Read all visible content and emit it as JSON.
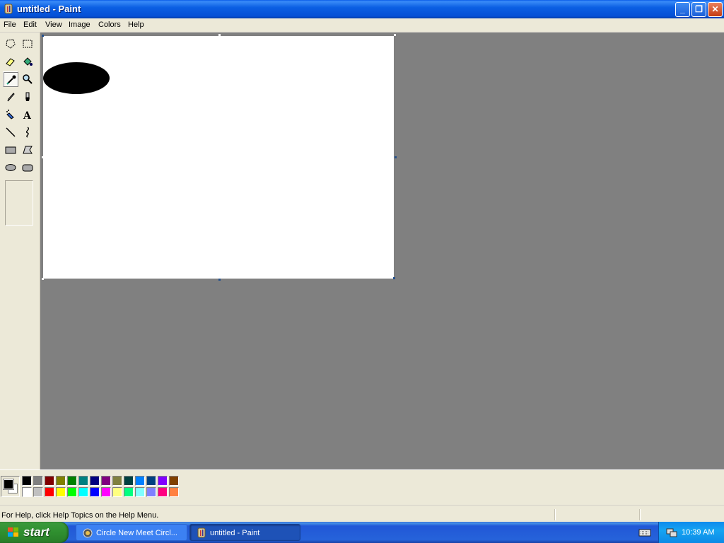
{
  "window": {
    "title": "untitled - Paint"
  },
  "menu": [
    "File",
    "Edit",
    "View",
    "Image",
    "Colors",
    "Help"
  ],
  "tools": [
    {
      "name": "free-form-select-icon"
    },
    {
      "name": "select-icon"
    },
    {
      "name": "eraser-icon"
    },
    {
      "name": "fill-bucket-icon"
    },
    {
      "name": "pick-color-icon",
      "active": true
    },
    {
      "name": "magnifier-icon"
    },
    {
      "name": "pencil-icon"
    },
    {
      "name": "brush-icon"
    },
    {
      "name": "airbrush-icon"
    },
    {
      "name": "text-icon"
    },
    {
      "name": "line-icon"
    },
    {
      "name": "curve-icon"
    },
    {
      "name": "rectangle-icon"
    },
    {
      "name": "polygon-icon"
    },
    {
      "name": "ellipse-icon"
    },
    {
      "name": "rounded-rectangle-icon"
    }
  ],
  "palette": {
    "foreground": "#000000",
    "background": "#ffffff",
    "row1": [
      "#000000",
      "#808080",
      "#800000",
      "#808000",
      "#008000",
      "#008080",
      "#000080",
      "#800080",
      "#808040",
      "#004040",
      "#0080ff",
      "#004080",
      "#8000ff",
      "#804000"
    ],
    "row2": [
      "#ffffff",
      "#c0c0c0",
      "#ff0000",
      "#ffff00",
      "#00ff00",
      "#00ffff",
      "#0000ff",
      "#ff00ff",
      "#ffff80",
      "#00ff80",
      "#80ffff",
      "#8080ff",
      "#ff0080",
      "#ff8040"
    ]
  },
  "status": {
    "help_text": "For Help, click Help Topics on the Help Menu."
  },
  "taskbar": {
    "start_label": "start",
    "items": [
      "Circle New Meet Circl...",
      "untitled - Paint"
    ],
    "clock": "10:39 AM"
  }
}
